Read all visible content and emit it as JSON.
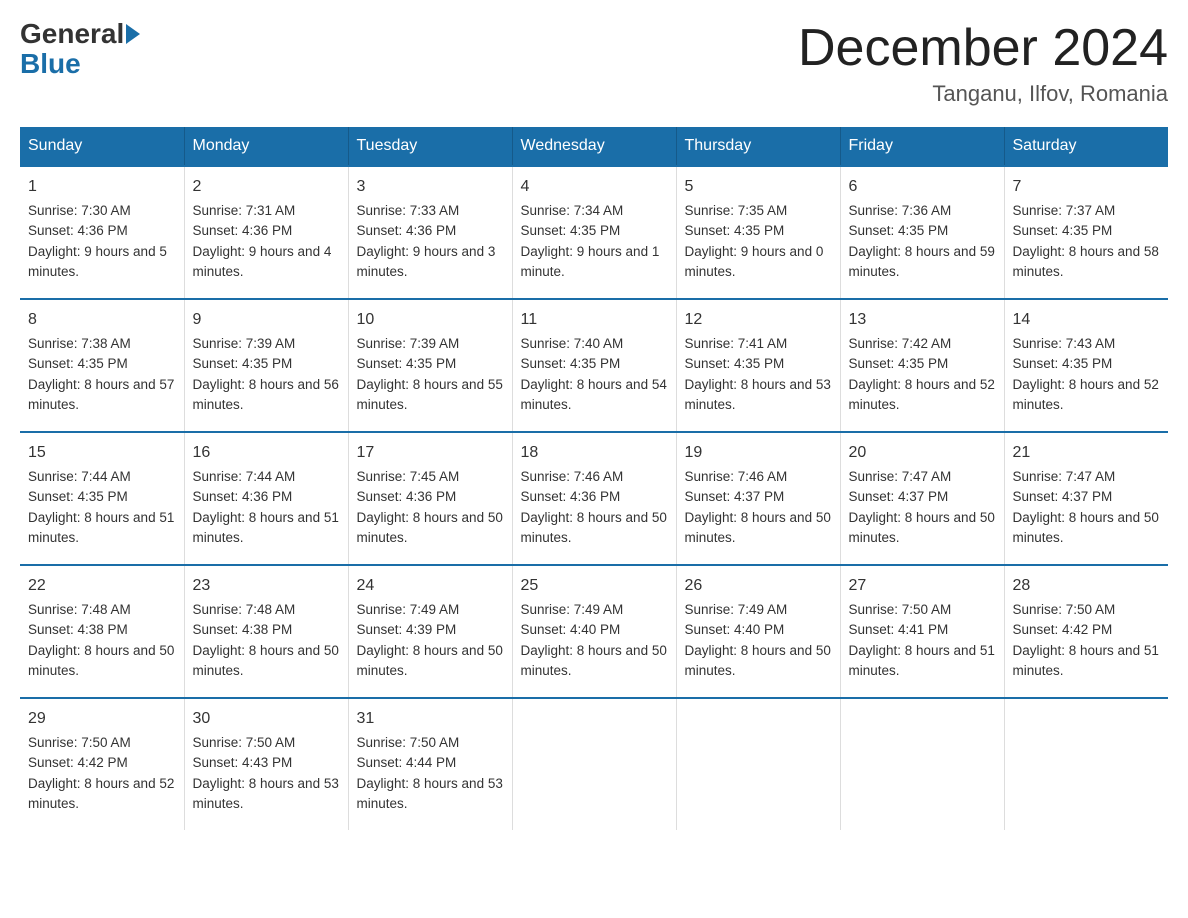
{
  "logo": {
    "general": "General",
    "blue": "Blue"
  },
  "header": {
    "month": "December 2024",
    "location": "Tanganu, Ilfov, Romania"
  },
  "days_of_week": [
    "Sunday",
    "Monday",
    "Tuesday",
    "Wednesday",
    "Thursday",
    "Friday",
    "Saturday"
  ],
  "weeks": [
    [
      {
        "day": "1",
        "sunrise": "7:30 AM",
        "sunset": "4:36 PM",
        "daylight": "9 hours and 5 minutes."
      },
      {
        "day": "2",
        "sunrise": "7:31 AM",
        "sunset": "4:36 PM",
        "daylight": "9 hours and 4 minutes."
      },
      {
        "day": "3",
        "sunrise": "7:33 AM",
        "sunset": "4:36 PM",
        "daylight": "9 hours and 3 minutes."
      },
      {
        "day": "4",
        "sunrise": "7:34 AM",
        "sunset": "4:35 PM",
        "daylight": "9 hours and 1 minute."
      },
      {
        "day": "5",
        "sunrise": "7:35 AM",
        "sunset": "4:35 PM",
        "daylight": "9 hours and 0 minutes."
      },
      {
        "day": "6",
        "sunrise": "7:36 AM",
        "sunset": "4:35 PM",
        "daylight": "8 hours and 59 minutes."
      },
      {
        "day": "7",
        "sunrise": "7:37 AM",
        "sunset": "4:35 PM",
        "daylight": "8 hours and 58 minutes."
      }
    ],
    [
      {
        "day": "8",
        "sunrise": "7:38 AM",
        "sunset": "4:35 PM",
        "daylight": "8 hours and 57 minutes."
      },
      {
        "day": "9",
        "sunrise": "7:39 AM",
        "sunset": "4:35 PM",
        "daylight": "8 hours and 56 minutes."
      },
      {
        "day": "10",
        "sunrise": "7:39 AM",
        "sunset": "4:35 PM",
        "daylight": "8 hours and 55 minutes."
      },
      {
        "day": "11",
        "sunrise": "7:40 AM",
        "sunset": "4:35 PM",
        "daylight": "8 hours and 54 minutes."
      },
      {
        "day": "12",
        "sunrise": "7:41 AM",
        "sunset": "4:35 PM",
        "daylight": "8 hours and 53 minutes."
      },
      {
        "day": "13",
        "sunrise": "7:42 AM",
        "sunset": "4:35 PM",
        "daylight": "8 hours and 52 minutes."
      },
      {
        "day": "14",
        "sunrise": "7:43 AM",
        "sunset": "4:35 PM",
        "daylight": "8 hours and 52 minutes."
      }
    ],
    [
      {
        "day": "15",
        "sunrise": "7:44 AM",
        "sunset": "4:35 PM",
        "daylight": "8 hours and 51 minutes."
      },
      {
        "day": "16",
        "sunrise": "7:44 AM",
        "sunset": "4:36 PM",
        "daylight": "8 hours and 51 minutes."
      },
      {
        "day": "17",
        "sunrise": "7:45 AM",
        "sunset": "4:36 PM",
        "daylight": "8 hours and 50 minutes."
      },
      {
        "day": "18",
        "sunrise": "7:46 AM",
        "sunset": "4:36 PM",
        "daylight": "8 hours and 50 minutes."
      },
      {
        "day": "19",
        "sunrise": "7:46 AM",
        "sunset": "4:37 PM",
        "daylight": "8 hours and 50 minutes."
      },
      {
        "day": "20",
        "sunrise": "7:47 AM",
        "sunset": "4:37 PM",
        "daylight": "8 hours and 50 minutes."
      },
      {
        "day": "21",
        "sunrise": "7:47 AM",
        "sunset": "4:37 PM",
        "daylight": "8 hours and 50 minutes."
      }
    ],
    [
      {
        "day": "22",
        "sunrise": "7:48 AM",
        "sunset": "4:38 PM",
        "daylight": "8 hours and 50 minutes."
      },
      {
        "day": "23",
        "sunrise": "7:48 AM",
        "sunset": "4:38 PM",
        "daylight": "8 hours and 50 minutes."
      },
      {
        "day": "24",
        "sunrise": "7:49 AM",
        "sunset": "4:39 PM",
        "daylight": "8 hours and 50 minutes."
      },
      {
        "day": "25",
        "sunrise": "7:49 AM",
        "sunset": "4:40 PM",
        "daylight": "8 hours and 50 minutes."
      },
      {
        "day": "26",
        "sunrise": "7:49 AM",
        "sunset": "4:40 PM",
        "daylight": "8 hours and 50 minutes."
      },
      {
        "day": "27",
        "sunrise": "7:50 AM",
        "sunset": "4:41 PM",
        "daylight": "8 hours and 51 minutes."
      },
      {
        "day": "28",
        "sunrise": "7:50 AM",
        "sunset": "4:42 PM",
        "daylight": "8 hours and 51 minutes."
      }
    ],
    [
      {
        "day": "29",
        "sunrise": "7:50 AM",
        "sunset": "4:42 PM",
        "daylight": "8 hours and 52 minutes."
      },
      {
        "day": "30",
        "sunrise": "7:50 AM",
        "sunset": "4:43 PM",
        "daylight": "8 hours and 53 minutes."
      },
      {
        "day": "31",
        "sunrise": "7:50 AM",
        "sunset": "4:44 PM",
        "daylight": "8 hours and 53 minutes."
      },
      null,
      null,
      null,
      null
    ]
  ],
  "labels": {
    "sunrise": "Sunrise:",
    "sunset": "Sunset:",
    "daylight": "Daylight:"
  }
}
